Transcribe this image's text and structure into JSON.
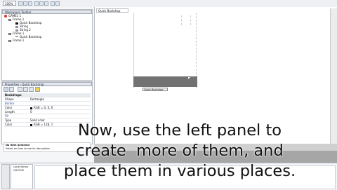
{
  "toolbar": {
    "zoom": "100%"
  },
  "workspace_panel": {
    "title": "Workspace Toolbar",
    "tree": [
      {
        "label": "GAME1 1",
        "icon": "red-gear-icon"
      },
      {
        "label": "Frame 1",
        "icon": "frame-icon"
      },
      {
        "label": "Quick Backdrop",
        "icon": "black-square-icon"
      },
      {
        "label": "String",
        "icon": "string-icon"
      },
      {
        "label": "String 2",
        "icon": "string-icon"
      },
      {
        "label": "Frame 1",
        "icon": "frame-icon"
      },
      {
        "label": "Quick Backdrop",
        "icon": "dash-icon"
      },
      {
        "label": "Frame 1",
        "icon": "frame-icon"
      }
    ]
  },
  "properties_panel": {
    "title": "Properties - Quick Backdrop",
    "section": "Backdrops",
    "rows": [
      {
        "key": "Shape",
        "value": "Rectangle",
        "swatch": false
      },
      {
        "key": "Border",
        "value": "",
        "swatch": false
      },
      {
        "key": "Color",
        "value": "RGB = 0, 0, 0",
        "swatch": true
      },
      {
        "key": "Length",
        "value": "0",
        "swatch": false
      },
      {
        "key": "Fill",
        "value": "",
        "swatch": false
      },
      {
        "key": "Type",
        "value": "Solid color",
        "swatch": false
      },
      {
        "key": "Color",
        "value": "RGB = 128, 1",
        "swatch": true
      }
    ],
    "desc_title": "No Item Selected",
    "desc_text": "Select an item to see its description"
  },
  "canvas": {
    "tab": "Quick Backdrop",
    "tooltip": "Quick Backdrop"
  },
  "library": {
    "items": [
      "Local library",
      "CD-ROM"
    ]
  },
  "caption": {
    "line1": "Now, use the left panel to",
    "line2": "create  more of them, and",
    "line3": "place them in various places."
  },
  "colors": {
    "canvas_bar": "#727272",
    "scroll_gray": "#a6a6a6"
  }
}
